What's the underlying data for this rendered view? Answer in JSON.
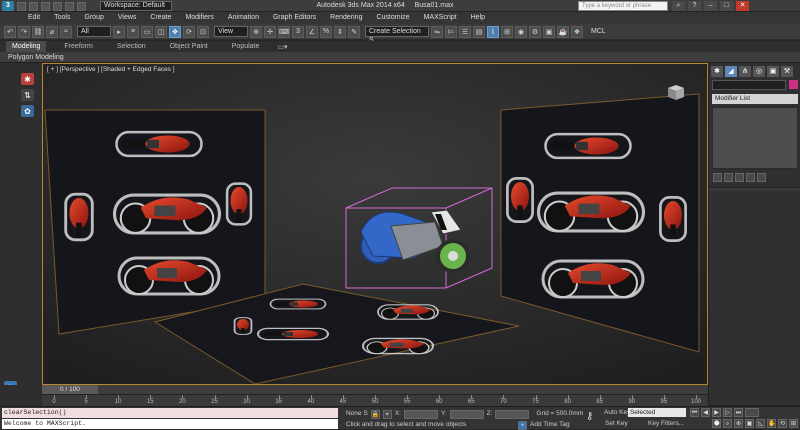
{
  "titlebar": {
    "workspace": "Workspace: Default",
    "app_title": "Autodesk 3ds Max  2014 x64",
    "file_name": "Busa01.max",
    "search_placeholder": "Type a keyword or phrase"
  },
  "menu": [
    "Edit",
    "Tools",
    "Group",
    "Views",
    "Create",
    "Modifiers",
    "Animation",
    "Graph Editors",
    "Rendering",
    "Customize",
    "MAXScript",
    "Help"
  ],
  "toolbar": {
    "selection_filter": "All",
    "ref_coord": "View",
    "named_selection": "Create Selection S",
    "mcl_label": "MCL"
  },
  "ribbon": {
    "tabs": [
      "Modeling",
      "Freeform",
      "Selection",
      "Object Paint",
      "Populate"
    ],
    "active_tab": "Modeling",
    "sub_label": "Polygon Modeling"
  },
  "viewport": {
    "label": "[ + ] [Perspective ] [Shaded + Edged Faces ]"
  },
  "command_panel": {
    "modifier_list": "Modifier List",
    "name_swatch_color": "#cf2f84"
  },
  "timeline": {
    "frame_readout": "0 / 100",
    "ticks": [
      0,
      5,
      10,
      15,
      20,
      25,
      30,
      35,
      40,
      45,
      50,
      55,
      60,
      65,
      70,
      75,
      80,
      85,
      90,
      95,
      100
    ]
  },
  "status": {
    "maxscript_line1": "clearSelection()",
    "maxscript_line2": "Welcome to MAXScript.",
    "selection_count": "None S",
    "x_label": "X:",
    "y_label": "Y:",
    "z_label": "Z:",
    "grid": "Grid = 500.0mm",
    "prompt": "Click and drag to select and move objects",
    "add_time_tag": "Add Time Tag",
    "auto_key": "Auto Key",
    "set_key": "Set Key",
    "selected": "Selected",
    "key_filters": "Key Filters..."
  },
  "colors": {
    "viewport_border": "#b38a2e",
    "active_tool": "#4d7fb0",
    "bike_red": "#c8281e"
  }
}
